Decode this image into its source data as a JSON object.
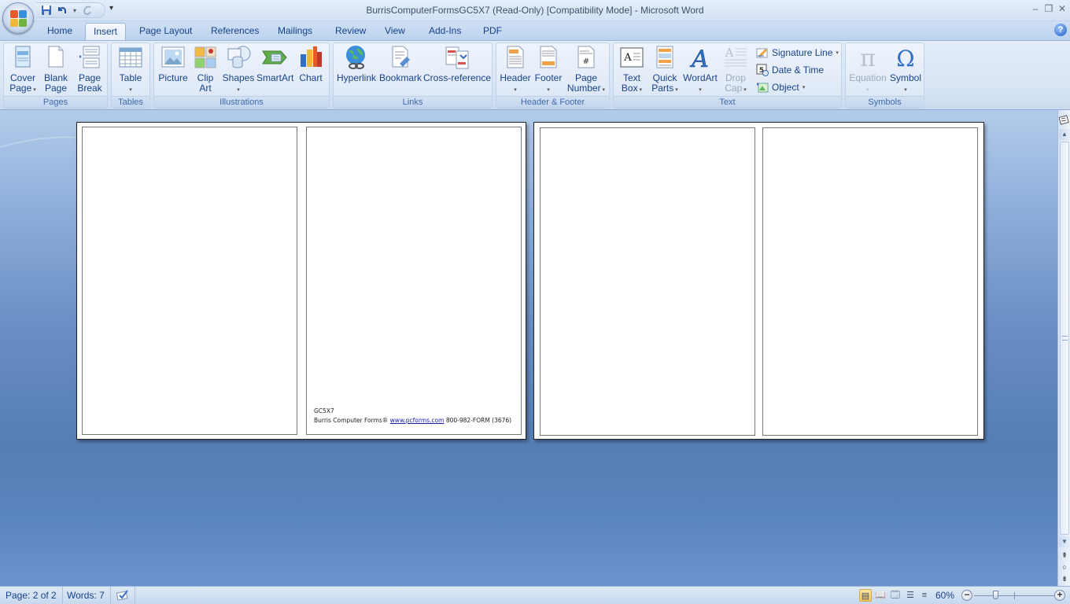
{
  "window": {
    "title": "BurrisComputerFormsGC5X7 (Read-Only) [Compatibility Mode] - Microsoft Word",
    "controls": {
      "minimize": "–",
      "restore": "❐",
      "close": "✕"
    }
  },
  "quick_access": {
    "save_icon": "save-icon",
    "undo_icon": "undo-icon",
    "redo_icon": "redo-icon",
    "customize": "▾"
  },
  "tabs": [
    {
      "label": "Home",
      "active": false
    },
    {
      "label": "Insert",
      "active": true
    },
    {
      "label": "Page Layout",
      "active": false
    },
    {
      "label": "References",
      "active": false
    },
    {
      "label": "Mailings",
      "active": false
    },
    {
      "label": "Review",
      "active": false
    },
    {
      "label": "View",
      "active": false
    },
    {
      "label": "Add-Ins",
      "active": false
    },
    {
      "label": "PDF",
      "active": false
    }
  ],
  "help": "?",
  "ribbon": {
    "groups": {
      "pages": {
        "label": "Pages",
        "buttons": [
          {
            "line1": "Cover",
            "line2": "Page",
            "dropdown": true
          },
          {
            "line1": "Blank",
            "line2": "Page",
            "dropdown": false
          },
          {
            "line1": "Page",
            "line2": "Break",
            "dropdown": false
          }
        ]
      },
      "tables": {
        "label": "Tables",
        "buttons": [
          {
            "line1": "Table",
            "dropdown": true
          }
        ]
      },
      "illustrations": {
        "label": "Illustrations",
        "buttons": [
          {
            "line1": "Picture"
          },
          {
            "line1": "Clip",
            "line2": "Art"
          },
          {
            "line1": "Shapes",
            "dropdown": true
          },
          {
            "line1": "SmartArt"
          },
          {
            "line1": "Chart"
          }
        ]
      },
      "links": {
        "label": "Links",
        "buttons": [
          {
            "line1": "Hyperlink"
          },
          {
            "line1": "Bookmark"
          },
          {
            "line1": "Cross-reference"
          }
        ]
      },
      "header_footer": {
        "label": "Header & Footer",
        "buttons": [
          {
            "line1": "Header",
            "dropdown": true
          },
          {
            "line1": "Footer",
            "dropdown": true
          },
          {
            "line1": "Page",
            "line2": "Number",
            "dropdown": true
          }
        ]
      },
      "text": {
        "label": "Text",
        "buttons": [
          {
            "line1": "Text",
            "line2": "Box",
            "dropdown": true
          },
          {
            "line1": "Quick",
            "line2": "Parts",
            "dropdown": true
          },
          {
            "line1": "WordArt",
            "dropdown": true
          },
          {
            "line1": "Drop",
            "line2": "Cap",
            "dropdown": true,
            "disabled": true
          }
        ],
        "small_buttons": [
          {
            "label": "Signature Line",
            "dropdown": true
          },
          {
            "label": "Date & Time",
            "dropdown": false
          },
          {
            "label": "Object",
            "dropdown": true
          }
        ]
      },
      "symbols": {
        "label": "Symbols",
        "buttons": [
          {
            "line1": "Equation",
            "dropdown": true,
            "disabled": true
          },
          {
            "line1": "Symbol",
            "dropdown": true
          }
        ]
      }
    }
  },
  "document": {
    "footer_line1": "GC5X7",
    "footer_company": "Burris Computer Forms®",
    "footer_link": "www.pcforms.com",
    "footer_phone": "800-982-FORM (3676)"
  },
  "status": {
    "page": "Page: 2 of 2",
    "words": "Words: 7",
    "zoom": "60%",
    "zoom_percent": 60,
    "active_view": "Print Layout"
  },
  "colors": {
    "ribbon_text": "#15428b",
    "link": "#1a1aa8",
    "workspace": "#567eb4"
  }
}
